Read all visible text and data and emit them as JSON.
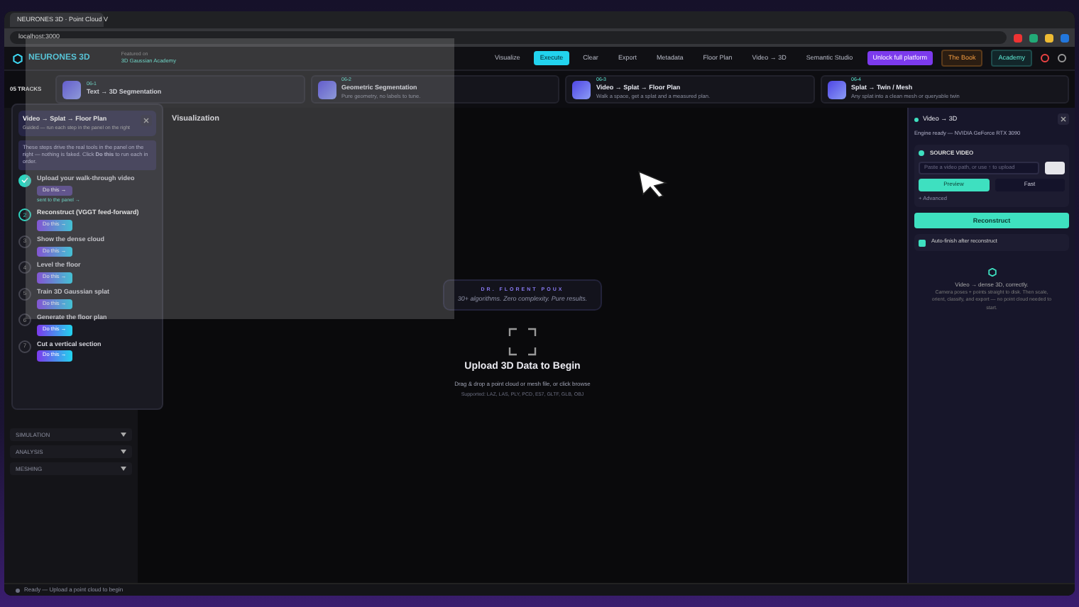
{
  "browser": {
    "tab_title": "NEURONES 3D · Point Cloud V",
    "address": "localhost:3000"
  },
  "header": {
    "logo": "NEURONES 3D",
    "featured_label": "Featured on",
    "featured_name": "3D Gaussian Academy",
    "nav": [
      {
        "label": "Visualize",
        "kind": "plain",
        "selected": false
      },
      {
        "label": "Execute",
        "kind": "plain",
        "selected": true
      },
      {
        "label": "Clear",
        "kind": "plain",
        "selected": false
      },
      {
        "label": "Export",
        "kind": "plain",
        "selected": false
      },
      {
        "label": "Metadata",
        "kind": "plain",
        "selected": false
      },
      {
        "label": "Floor Plan",
        "kind": "plain",
        "selected": false
      },
      {
        "label": "Video → 3D",
        "kind": "plain",
        "selected": false
      },
      {
        "label": "Semantic Studio",
        "kind": "plain",
        "selected": false
      },
      {
        "label": "Unlock full platform",
        "kind": "promo",
        "selected": false
      },
      {
        "label": "The Book",
        "kind": "book",
        "selected": false
      },
      {
        "label": "Academy",
        "kind": "academy",
        "selected": false
      }
    ]
  },
  "tracks": {
    "title": "05 TRACKS",
    "cards": [
      {
        "code": "06-1",
        "title": "Text → 3D Segmentation"
      },
      {
        "code": "06-2",
        "title": "Geometric Segmentation",
        "subtitle": "Pure geometry, no labels to tune."
      },
      {
        "code": "06-3",
        "title": "Video → Splat → Floor Plan",
        "subtitle": "Walk a space, get a splat and a measured plan."
      },
      {
        "code": "06-4",
        "title": "Splat → Twin / Mesh",
        "subtitle": "Any splat into a clean mesh or queryable twin"
      }
    ]
  },
  "tutorial": {
    "title": "Video → Splat → Floor Plan",
    "subtitle": "Guided — run each step in the panel on the right",
    "intro": "These steps drive the real tools in the panel on the right — nothing is faked. Click **Do this** to run each in order.",
    "steps": [
      {
        "title": "Upload your walk-through video",
        "done": true,
        "current": false,
        "button": "Do this →",
        "note": "sent to the panel →"
      },
      {
        "number": "2",
        "title": "Reconstruct (VGGT feed-forward)",
        "done": false,
        "current": true,
        "button": "Do this →"
      },
      {
        "number": "3",
        "title": "Show the dense cloud",
        "done": false,
        "current": false,
        "button": "Do this →"
      },
      {
        "number": "4",
        "title": "Level the floor",
        "done": false,
        "current": false,
        "button": "Do this →"
      },
      {
        "number": "5",
        "title": "Train 3D Gaussian splat",
        "done": false,
        "current": false,
        "button": "Do this →"
      },
      {
        "number": "6",
        "title": "Generate the floor plan",
        "done": false,
        "current": false,
        "button": "Do this →"
      },
      {
        "number": "7",
        "title": "Cut a vertical section",
        "done": false,
        "current": false,
        "button": "Do this →"
      }
    ]
  },
  "sidebar_sections": [
    {
      "label": "SIMULATION"
    },
    {
      "label": "ANALYSIS"
    },
    {
      "label": "MESHING"
    }
  ],
  "main": {
    "title": "Visualization",
    "credit": "DR. FLORENT POUX",
    "tagline": "30+ algorithms. Zero complexity. Pure results.",
    "upload_title": "Upload 3D Data to Begin",
    "upload_hint": "Drag & drop a point cloud or mesh file, or click browse",
    "formats": "Supported: LAZ, LAS, PLY, PCD, E57, GLTF, GLB, OBJ"
  },
  "video_panel": {
    "title": "Video → 3D",
    "engine": "Engine ready — NVIDIA GeForce RTX 3090",
    "section": "SOURCE VIDEO",
    "placeholder": "Paste a video path, or use ↑ to upload",
    "modes": [
      {
        "label": "Preview",
        "selected": true
      },
      {
        "label": "Fast",
        "selected": false
      }
    ],
    "advanced": "+ Advanced",
    "reconstruct": "Reconstruct",
    "auto_finish": {
      "label": "Auto-finish after reconstruct",
      "checked": true
    },
    "empty_title": "Video → dense 3D, correctly.",
    "empty_text": "Camera poses + points straight to disk. Then scale, orient, classify, and export — no point cloud needed to start."
  },
  "status_bar": "Ready — Upload a point cloud to begin"
}
